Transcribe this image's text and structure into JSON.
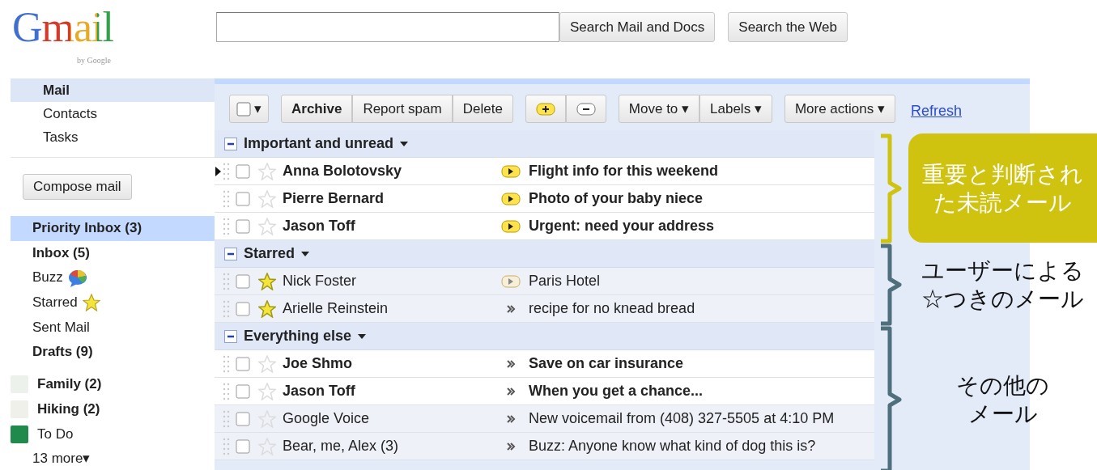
{
  "logo": {
    "text": "Gmail",
    "subtitle": "by Google"
  },
  "search": {
    "buttons": [
      "Search Mail and Docs",
      "Search the Web"
    ]
  },
  "apps": [
    {
      "label": "Mail",
      "selected": true
    },
    {
      "label": "Contacts",
      "selected": false
    },
    {
      "label": "Tasks",
      "selected": false
    }
  ],
  "compose_button": "Compose mail",
  "folders": [
    {
      "kind": "folder",
      "label": "Priority Inbox (3)",
      "bold": true,
      "selected": true
    },
    {
      "kind": "folder",
      "label": "Inbox (5)",
      "bold": true,
      "selected": false
    },
    {
      "kind": "buzz",
      "label": "Buzz",
      "bold": false,
      "selected": false
    },
    {
      "kind": "starred",
      "label": "Starred",
      "bold": false,
      "selected": false
    },
    {
      "kind": "folder",
      "label": "Sent Mail",
      "bold": false,
      "selected": false
    },
    {
      "kind": "folder",
      "label": "Drafts (9)",
      "bold": true,
      "selected": false
    },
    {
      "kind": "label",
      "label": "Family (2)",
      "bold": true,
      "selected": false,
      "color": "#ecf1ec"
    },
    {
      "kind": "label",
      "label": "Hiking (2)",
      "bold": true,
      "selected": false,
      "color": "#eff0ea"
    },
    {
      "kind": "label",
      "label": "To Do",
      "bold": false,
      "selected": false,
      "color": "#1f8a4c"
    },
    {
      "kind": "more",
      "label": "13 more▾",
      "bold": false,
      "selected": false
    }
  ],
  "toolbar": {
    "select_caret": "▾",
    "groups": [
      [
        {
          "kind": "text",
          "label": "Archive",
          "bold": true
        },
        {
          "kind": "text",
          "label": "Report spam",
          "bold": false
        },
        {
          "kind": "text",
          "label": "Delete",
          "bold": false
        }
      ],
      [
        {
          "kind": "plus"
        },
        {
          "kind": "minus"
        }
      ],
      [
        {
          "kind": "text",
          "label": "Move to ▾",
          "bold": false
        },
        {
          "kind": "text",
          "label": "Labels ▾",
          "bold": false
        }
      ],
      [
        {
          "kind": "text",
          "label": "More actions ▾",
          "bold": false
        }
      ]
    ],
    "refresh": "Refresh"
  },
  "sections": [
    {
      "title": "Important and unread",
      "expanded": true,
      "rows": [
        {
          "sender": "Anna Bolotovsky",
          "subject": "Flight info for this weekend",
          "unread": true,
          "starred": false,
          "checked": false,
          "focused": true,
          "important": true
        },
        {
          "sender": "Pierre Bernard",
          "subject": "Photo of your baby niece",
          "unread": true,
          "starred": false,
          "checked": false,
          "focused": false,
          "important": true
        },
        {
          "sender": "Jason Toff",
          "subject": "Urgent: need your address",
          "unread": true,
          "starred": false,
          "checked": false,
          "focused": false,
          "important": true
        }
      ]
    },
    {
      "title": "Starred",
      "expanded": true,
      "rows": [
        {
          "sender": "Nick Foster",
          "subject": "Paris Hotel",
          "unread": false,
          "starred": true,
          "checked": false,
          "focused": false,
          "important": true
        },
        {
          "sender": "Arielle Reinstein",
          "subject": "recipe for no knead bread",
          "unread": false,
          "starred": true,
          "checked": false,
          "focused": false,
          "important": false
        }
      ]
    },
    {
      "title": "Everything else",
      "expanded": true,
      "rows": [
        {
          "sender": "Joe Shmo",
          "subject": "Save on car insurance",
          "unread": true,
          "starred": false,
          "checked": false,
          "focused": false,
          "important": false
        },
        {
          "sender": "Jason Toff",
          "subject": "When you get a chance...",
          "unread": true,
          "starred": false,
          "checked": false,
          "focused": false,
          "important": false
        },
        {
          "sender": "Google Voice",
          "subject": "New voicemail from (408) 327-5505 at 4:10 PM",
          "unread": false,
          "starred": false,
          "checked": false,
          "focused": false,
          "important": false
        },
        {
          "sender": "Bear, me, Alex (3)",
          "subject": "Buzz: Anyone know what kind of dog this is?",
          "unread": false,
          "starred": false,
          "checked": false,
          "focused": false,
          "important": false
        }
      ]
    }
  ],
  "annotations": [
    {
      "lines": [
        "重要と判断され",
        "た未読メール"
      ],
      "color": "#cfc30f",
      "filled": true
    },
    {
      "lines": [
        "ユーザーによる",
        "☆つきのメール"
      ],
      "color": "#4e6f7b",
      "filled": false
    },
    {
      "lines": [
        "その他の",
        "メール"
      ],
      "color": "#4e6f7b",
      "filled": false
    }
  ]
}
